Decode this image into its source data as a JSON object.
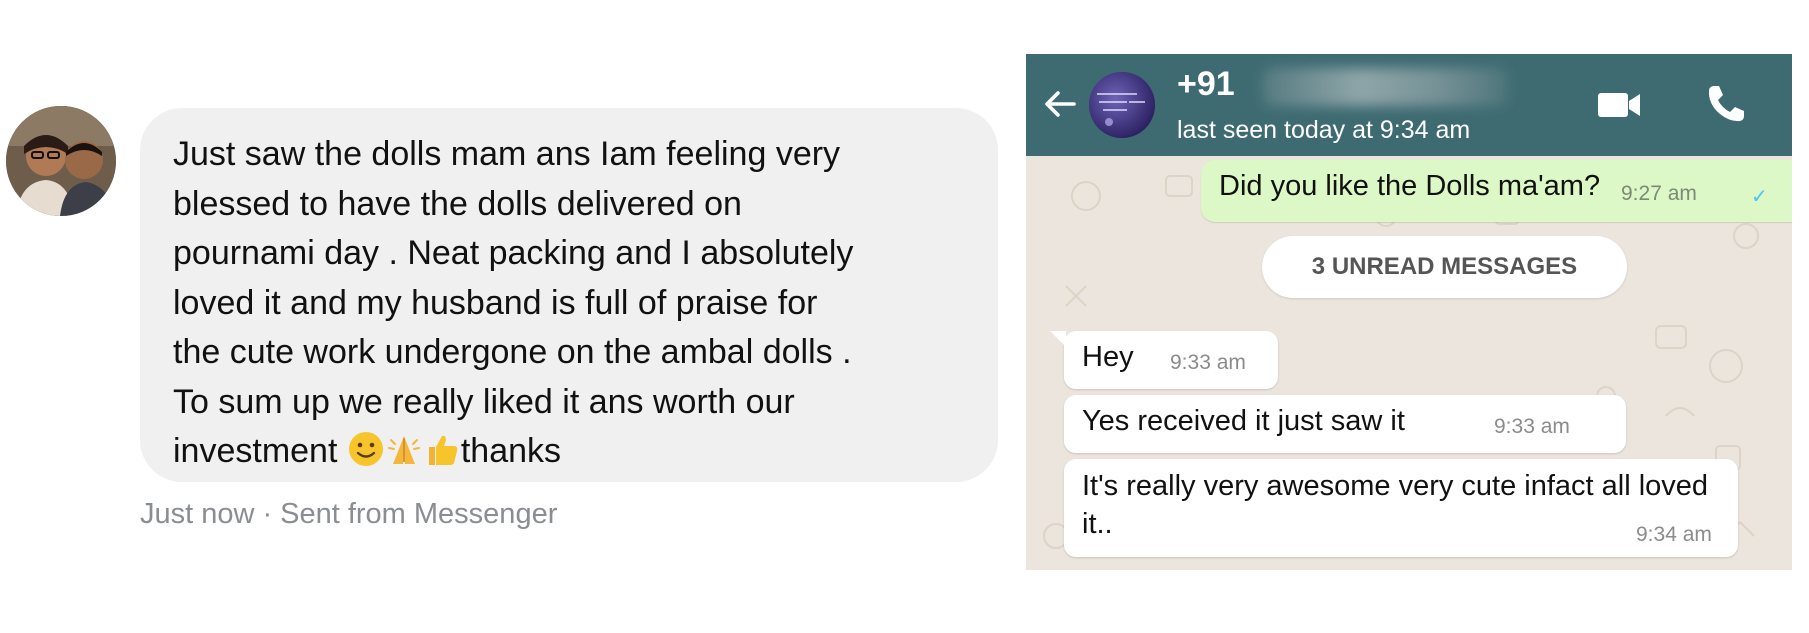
{
  "messenger": {
    "message_lines": [
      "Just saw the dolls mam ans Iam feeling very",
      "blessed to have the dolls delivered on",
      "pournami day . Neat packing and I absolutely",
      "loved it and my husband is full of praise for",
      "the cute work undergone on the ambal dolls .",
      "To sum up we really liked it ans worth our",
      "investment"
    ],
    "message_end": "thanks",
    "emojis": [
      "slightly-smiling-face",
      "folded-hands",
      "thumbs-up"
    ],
    "meta_time": "Just now",
    "meta_separator": "·",
    "meta_source": "Sent from Messenger"
  },
  "whatsapp": {
    "header": {
      "contact_prefix": "+91",
      "last_seen": "last seen today at 9:34 am",
      "header_color": "#3e6b72"
    },
    "outgoing": {
      "text": "Did you like the Dolls ma'am?",
      "time": "9:27 am",
      "tick": "✓"
    },
    "unread_banner": "3 UNREAD MESSAGES",
    "incoming": [
      {
        "text": "Hey",
        "time": "9:33 am"
      },
      {
        "text": "Yes received it just saw it",
        "time": "9:33 am"
      },
      {
        "text": "It's really very awesome very cute infact all loved it..",
        "time": "9:34 am"
      }
    ]
  }
}
